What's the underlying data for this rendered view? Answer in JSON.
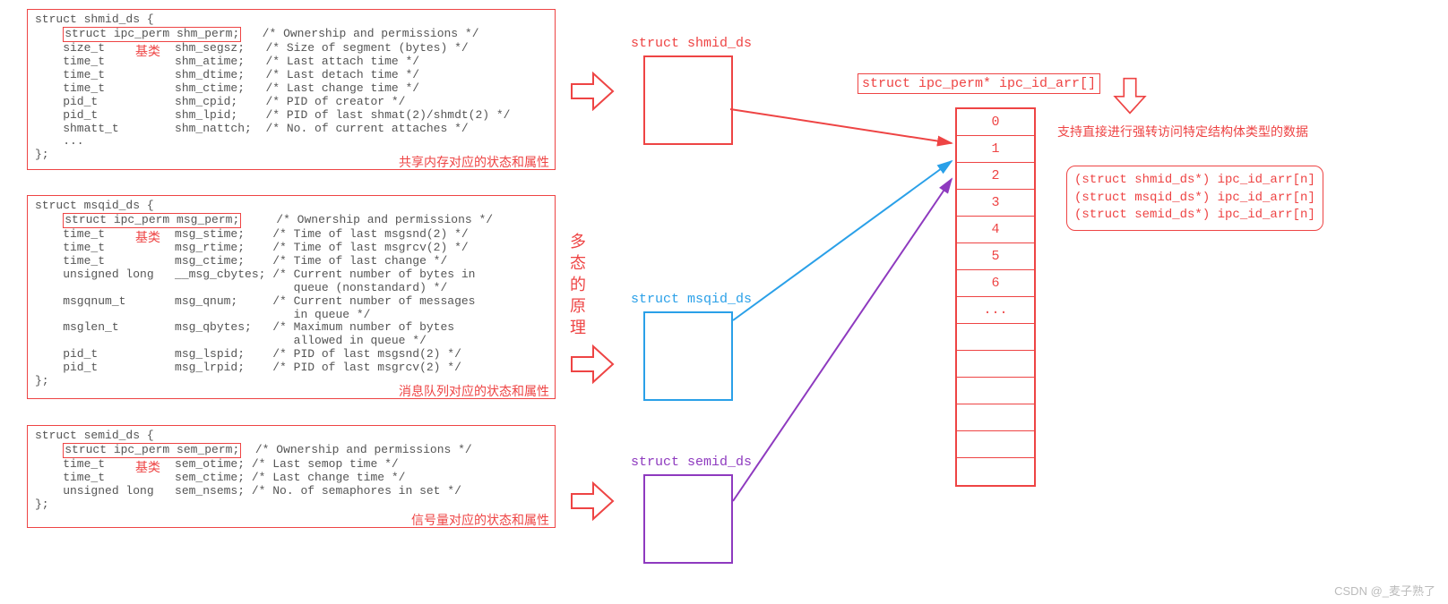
{
  "shm": {
    "decl": "struct shmid_ds {",
    "perm_line": "struct ipc_perm shm_perm;",
    "perm_comment": "   /* Ownership and permissions */",
    "base_label": "基类",
    "lines": [
      "    size_t          shm_segsz;   /* Size of segment (bytes) */",
      "    time_t          shm_atime;   /* Last attach time */",
      "    time_t          shm_dtime;   /* Last detach time */",
      "    time_t          shm_ctime;   /* Last change time */",
      "    pid_t           shm_cpid;    /* PID of creator */",
      "    pid_t           shm_lpid;    /* PID of last shmat(2)/shmdt(2) */",
      "    shmatt_t        shm_nattch;  /* No. of current attaches */",
      "    ...",
      "};"
    ],
    "note": "共享内存对应的状态和属性",
    "title": "struct shmid_ds"
  },
  "msg": {
    "decl": "struct msqid_ds {",
    "perm_line": "struct ipc_perm msg_perm;",
    "perm_comment": "     /* Ownership and permissions */",
    "base_label": "基类",
    "lines": [
      "    time_t          msg_stime;    /* Time of last msgsnd(2) */",
      "    time_t          msg_rtime;    /* Time of last msgrcv(2) */",
      "    time_t          msg_ctime;    /* Time of last change */",
      "    unsigned long   __msg_cbytes; /* Current number of bytes in",
      "                                     queue (nonstandard) */",
      "    msgqnum_t       msg_qnum;     /* Current number of messages",
      "                                     in queue */",
      "    msglen_t        msg_qbytes;   /* Maximum number of bytes",
      "                                     allowed in queue */",
      "    pid_t           msg_lspid;    /* PID of last msgsnd(2) */",
      "    pid_t           msg_lrpid;    /* PID of last msgrcv(2) */",
      "};"
    ],
    "note": "消息队列对应的状态和属性",
    "title": "struct msqid_ds"
  },
  "sem": {
    "decl": "struct semid_ds {",
    "perm_line": "struct ipc_perm sem_perm;",
    "perm_comment": "  /* Ownership and permissions */",
    "base_label": "基类",
    "lines": [
      "    time_t          sem_otime; /* Last semop time */",
      "    time_t          sem_ctime; /* Last change time */",
      "    unsigned long   sem_nsems; /* No. of semaphores in set */",
      "};"
    ],
    "note": "信号量对应的状态和属性",
    "title": "struct semid_ds"
  },
  "vert": "多态的原理",
  "arr_title": "struct ipc_perm* ipc_id_arr[]",
  "arr_cells": [
    "0",
    "1",
    "2",
    "3",
    "4",
    "5",
    "6",
    "...",
    "",
    "",
    "",
    "",
    "",
    ""
  ],
  "note_right": "支持直接进行强转访问特定结构体类型的数据",
  "casts": [
    "(struct shmid_ds*)  ipc_id_arr[n]",
    "(struct msqid_ds*)  ipc_id_arr[n]",
    "(struct semid_ds*)  ipc_id_arr[n]"
  ],
  "watermark": "CSDN @_麦子熟了"
}
